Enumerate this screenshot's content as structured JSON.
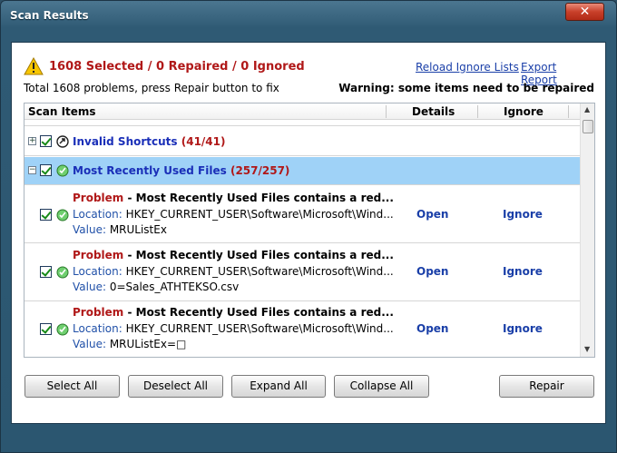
{
  "window": {
    "title": "Scan Results",
    "close_label": "✕"
  },
  "header": {
    "summary": "1608 Selected / 0 Repaired / 0 Ignored",
    "reload_link": "Reload Ignore Lists",
    "export_link": "Export Report",
    "subtext": "Total 1608 problems, press Repair button to fix",
    "warning": "Warning: some items need to be repaired"
  },
  "list": {
    "columns": {
      "items": "Scan Items",
      "details": "Details",
      "ignore": "Ignore"
    },
    "categories": [
      {
        "name": "Invalid Shortcuts",
        "count": "(41/41)",
        "expander": "+",
        "icon": "shortcut-icon"
      },
      {
        "name": "Most Recently Used Files",
        "count": "(257/257)",
        "expander": "−",
        "icon": "mru-icon"
      }
    ],
    "items": [
      {
        "problem_label": "Problem",
        "problem_text": " - Most Recently Used Files contains a red...",
        "location_key": "Location:",
        "location": " HKEY_CURRENT_USER\\Software\\Microsoft\\Wind...",
        "value_key": "Value:",
        "value": " MRUListEx",
        "open": "Open",
        "ignore": "Ignore"
      },
      {
        "problem_label": "Problem",
        "problem_text": " - Most Recently Used Files contains a red...",
        "location_key": "Location:",
        "location": " HKEY_CURRENT_USER\\Software\\Microsoft\\Wind...",
        "value_key": "Value:",
        "value": " 0=Sales_ATHTEKSO.csv",
        "open": "Open",
        "ignore": "Ignore"
      },
      {
        "problem_label": "Problem",
        "problem_text": " - Most Recently Used Files contains a red...",
        "location_key": "Location:",
        "location": " HKEY_CURRENT_USER\\Software\\Microsoft\\Wind...",
        "value_key": "Value:",
        "value": " MRUListEx=□",
        "open": "Open",
        "ignore": "Ignore"
      }
    ]
  },
  "buttons": {
    "select_all": "Select All",
    "deselect_all": "Deselect All",
    "expand_all": "Expand All",
    "collapse_all": "Collapse All",
    "repair": "Repair"
  },
  "colors": {
    "selected_row": "#9fd2f7",
    "problem_red": "#b01818",
    "link_blue": "#1a3fa8"
  }
}
